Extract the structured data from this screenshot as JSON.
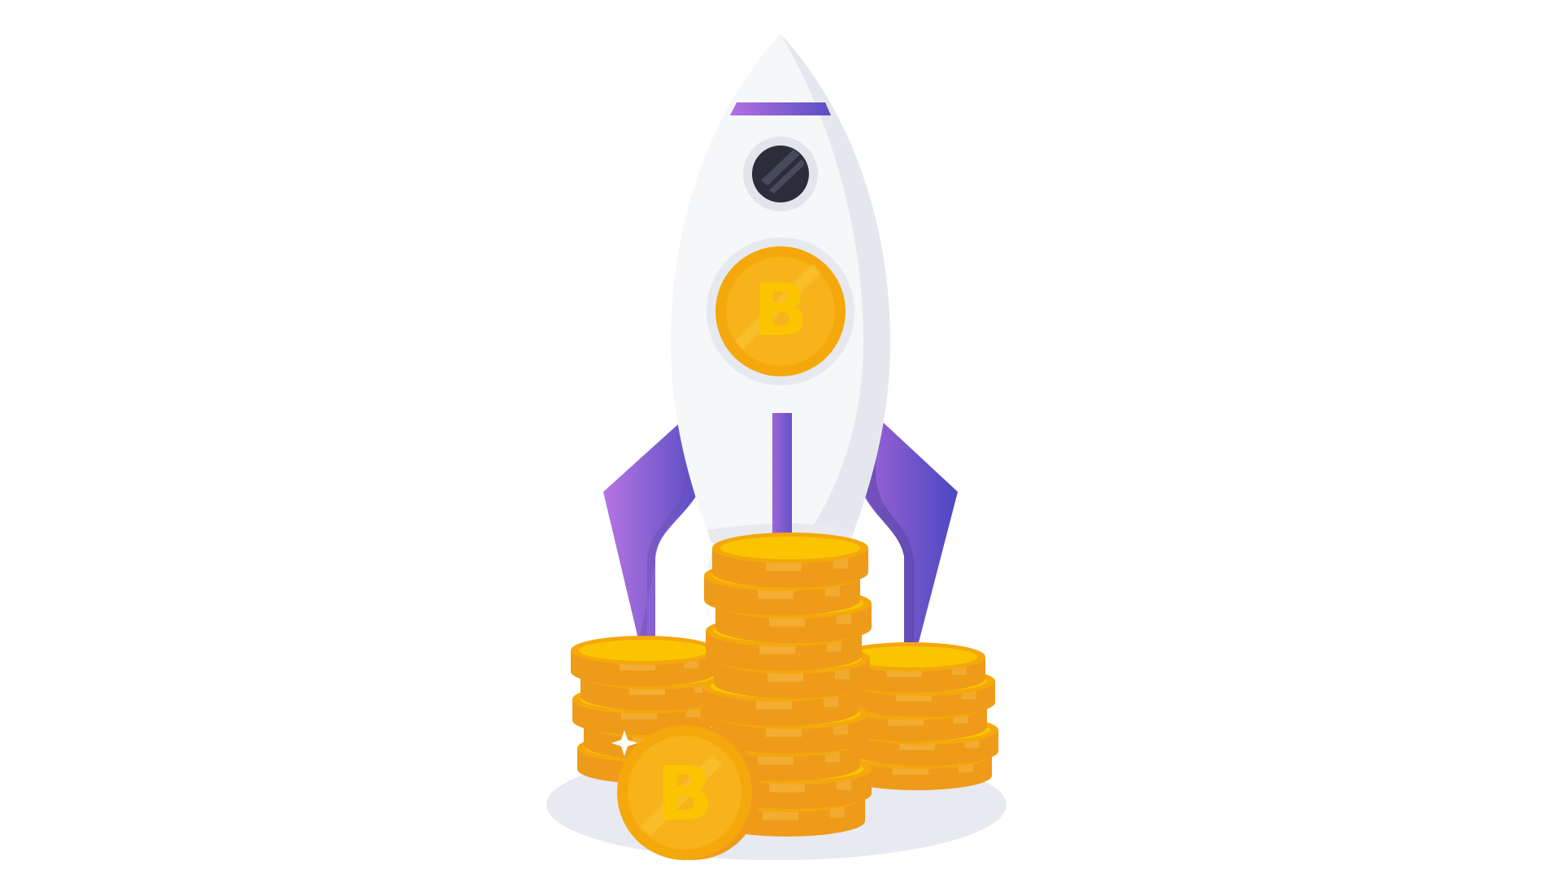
{
  "scene": {
    "subject": "rocket-with-coin-stacks",
    "coin_symbol": "B",
    "colors": {
      "background": "#ffffff",
      "rocket_body": "#f6f7f9",
      "rocket_shade": "#e4e7ee",
      "window_frame": "#e2e6ec",
      "window_glass": "#2b2d3a",
      "fin_light": "#b171e0",
      "fin_dark": "#5b4fc4",
      "coin_face": "#fbc400",
      "coin_rim": "#f4a80c",
      "coin_edge": "#ee9b1a",
      "coin_edge_band": "#f4b23a",
      "coin_letter": "#f2a50b",
      "ground_shadow": "#e8e9f1"
    },
    "stacks": [
      {
        "name": "left-stack",
        "coin_count": 5
      },
      {
        "name": "center-stack",
        "coin_count": 10
      },
      {
        "name": "right-stack",
        "coin_count": 5
      }
    ]
  }
}
